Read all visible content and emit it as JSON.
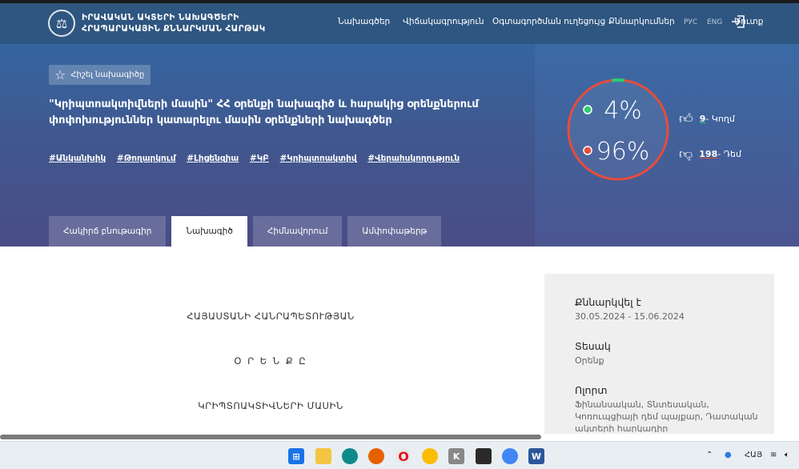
{
  "header": {
    "logo_line1": "ԻՐԱՎԱԿԱՆ ԱԿՏԵՐԻ ՆԱԽԱԳԾԵՐԻ",
    "logo_line2": "ՀՐԱՊԱՐԱԿԱՅԻՆ ՔՆՆԱՐԿՄԱՆ ՀԱՐԹԱԿ",
    "nav": [
      "Նախագծեր",
      "Վիճակագրություն",
      "Օգտագործման ուղեցույց",
      "Քննարկումներ"
    ],
    "lang_ru": "РУС",
    "lang_en": "ENG",
    "login": "Մուտք"
  },
  "hero": {
    "fav_button": "Հիշել նախագիծը",
    "title": "\"Կրիպտոակտիվների մասին\" ՀՀ օրենքի նախագիծ և հարակից օրենքներում փոփոխություններ կատարելու մասին օրենքների նախագծեր",
    "tags": [
      "#Անկանխիկ",
      "#Թողարկում",
      "#Լիցենզիա",
      "#ԿԲ",
      "#Կրիպտոակտիվ",
      "#Վերահսկողություն"
    ]
  },
  "tabs": [
    "Հակիրճ բնութագիր",
    "Նախագիծ",
    "Հիմնավորում",
    "Ամփոփաթերթ"
  ],
  "stats": {
    "yes_percent": "4%",
    "no_percent": "96%",
    "yes_fraction": 0.04,
    "yes_count": "9",
    "yes_label": " - Կողմ",
    "no_count": "198",
    "no_label": " - Դեմ",
    "yes_color": "#2ecc71",
    "no_color": "#e74c3c"
  },
  "document": {
    "line1": "ՀԱՅԱՍՏԱՆԻ ՀԱՆՐԱՊԵՏՈՒԹՅԱՆ",
    "line2": "Օ Ր Ե Ն Ք Ը",
    "line3": "ԿՐԻՊՏՈԱԿՏԻՎՆԵՐԻ ՄԱՍԻՆ"
  },
  "info": {
    "discussed_label": "Քննարկվել է",
    "discussed_value": "30.05.2024 - 15.06.2024",
    "type_label": "Տեսակ",
    "type_value": "Օրենք",
    "area_label": "Ոլորտ",
    "area_value": "Ֆինանսական, Տնտեսական, Կոռուպցիայի դեմ պայքար, Դատական ակտերի հարկադիր"
  },
  "taskbar": {
    "lang": "ՀԱՅ"
  }
}
